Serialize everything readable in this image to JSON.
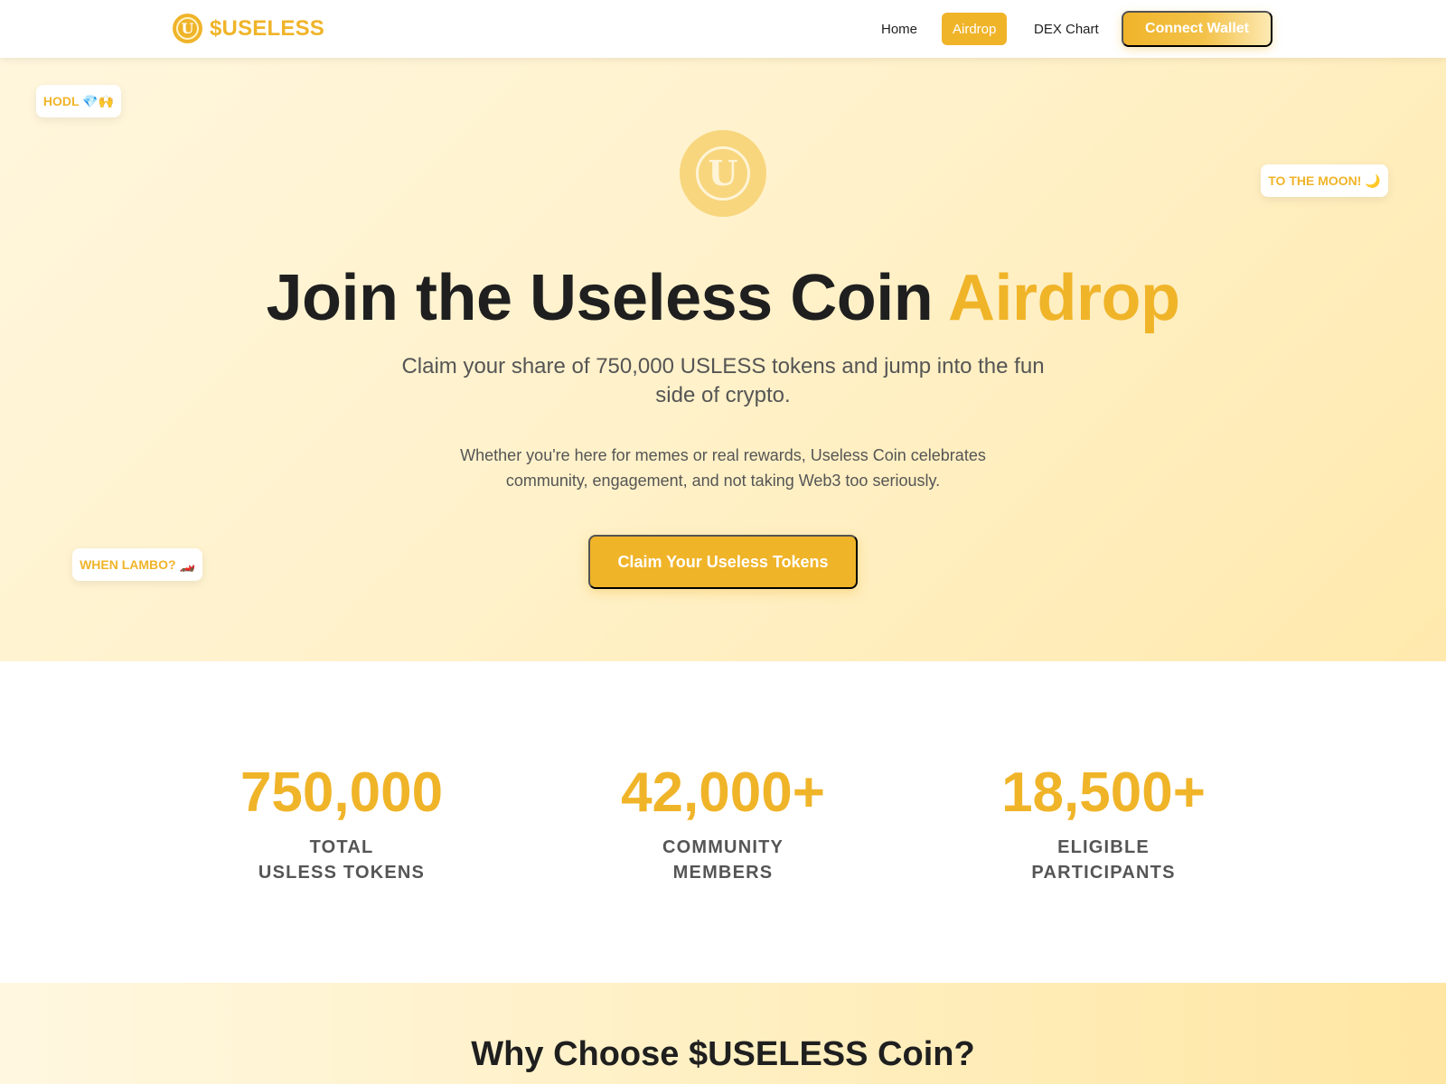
{
  "header": {
    "logo_letter": "U",
    "logo_text": "$USELESS",
    "nav": {
      "home": "Home",
      "airdrop": "Airdrop",
      "dex_chart": "DEX Chart"
    },
    "connect_wallet": "Connect Wallet"
  },
  "hero": {
    "tags": {
      "hodl": "HODL 💎🙌",
      "moon": "TO THE MOON! 🌙",
      "lambo": "WHEN LAMBO? 🏎️"
    },
    "coin_letter": "U",
    "title_main": "Join the Useless Coin ",
    "title_accent": "Airdrop",
    "subtitle": "Claim your share of 750,000 USLESS tokens and jump into the fun side of crypto.",
    "description": "Whether you're here for memes or real rewards, Useless Coin celebrates community, engagement, and not taking Web3 too seriously.",
    "claim_button": "Claim Your Useless Tokens"
  },
  "stats": [
    {
      "value": "750,000",
      "label": "TOTAL\nUSLESS TOKENS"
    },
    {
      "value": "42,000+",
      "label": "COMMUNITY\nMEMBERS"
    },
    {
      "value": "18,500+",
      "label": "ELIGIBLE\nPARTICIPANTS"
    }
  ],
  "why": {
    "title": "Why Choose $USELESS Coin?"
  },
  "colors": {
    "accent": "#f0b429",
    "text_dark": "#1f1f1f",
    "text_muted": "#555555",
    "hero_bg": "#fff1c9"
  }
}
